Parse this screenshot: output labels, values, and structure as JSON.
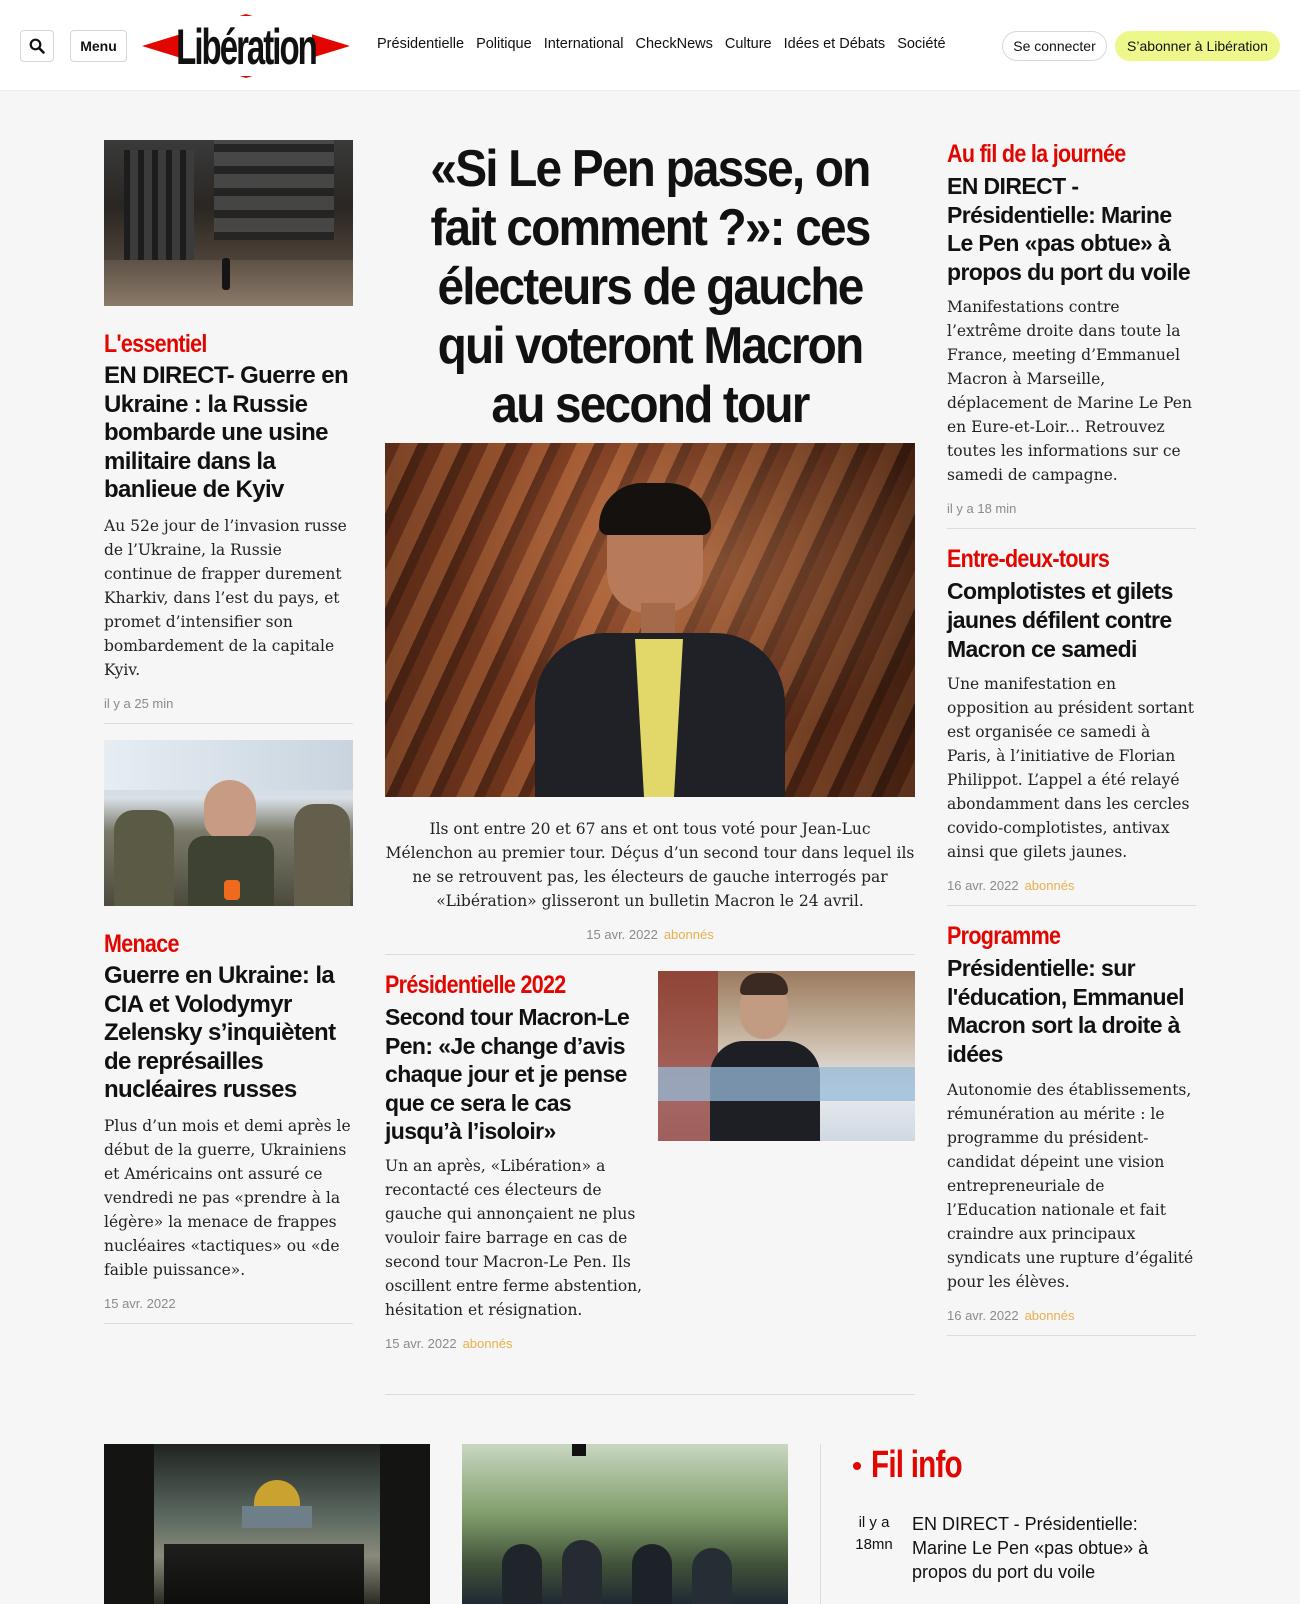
{
  "header": {
    "menu_label": "Menu",
    "logo_text": "Libération",
    "nav": [
      "Présidentielle",
      "Politique",
      "International",
      "CheckNews",
      "Culture",
      "Idées et Débats",
      "Société"
    ],
    "login_label": "Se connecter",
    "subscribe_label": "S’abonner à Libération"
  },
  "left": {
    "article1": {
      "rubric": "L'essentiel",
      "title": "EN DIRECT- Guerre en Ukraine : la Russie bombarde une usine militaire dans la banlieue de Kyiv",
      "excerpt": "Au 52e jour de l’invasion russe de l’Ukraine, la Russie continue de frapper durement Kharkiv, dans l’est du pays, et promet d’intensifier son bombardement de la capitale Kyiv.",
      "time": "il y a 25 min"
    },
    "article2": {
      "rubric": "Menace",
      "title": "Guerre en Ukraine: la CIA et Volodymyr Zelensky s’inquiètent de représailles nucléaires russes",
      "excerpt": "Plus d’un mois et demi après le début de la guerre, Ukrainiens et Américains ont assuré ce vendredi ne pas «prendre à la légère» la menace de frappes nucléaires «tactiques» ou «de faible puissance».",
      "time": "15 avr. 2022"
    }
  },
  "lead": {
    "title": "«Si Le Pen passe, on fait comment ?»: ces électeurs de gauche qui voteront Macron au second tour",
    "excerpt": "Ils ont entre 20 et 67 ans et ont tous voté pour Jean-Luc Mélenchon au premier tour. Déçus d’un second tour dans lequel ils ne se retrouvent pas, les électeurs de gauche interrogés par «Libération» glisseront un bulletin Macron le 24 avril.",
    "time": "15 avr. 2022",
    "badge": "abonnés"
  },
  "mid_secondary": {
    "rubric": "Présidentielle 2022",
    "title": "Second tour Macron-Le Pen: «Je change d’avis chaque jour et je pense que ce sera le cas jusqu’à l’isoloir»",
    "excerpt": "Un an après, «Libération» a recontacté ces électeurs de gauche qui annonçaient ne plus vouloir faire barrage en cas de second tour Macron-Le Pen. Ils oscillent entre ferme abstention, hésitation et résignation.",
    "time": "15 avr. 2022",
    "badge": "abonnés"
  },
  "right": {
    "article1": {
      "rubric": "Au fil de la journée",
      "title": "EN DIRECT - Présidentielle: Marine Le Pen «pas obtue» à propos du port du voile",
      "excerpt": "Manifestations contre l’extrême droite dans toute la France, meeting d’Emmanuel Macron à Marseille, déplacement de Marine Le Pen en Eure-et-Loir... Retrouvez toutes les informations sur ce samedi de campagne.",
      "time": "il y a 18 min"
    },
    "article2": {
      "rubric": "Entre-deux-tours",
      "title": "Complotistes et gilets jaunes défilent contre Macron ce samedi",
      "excerpt": "Une manifestation en opposition au président sortant est organisée ce samedi à Paris, à l’initiative de Florian Philippot. L’appel a été relayé abondamment dans les cercles covido-complotistes, antivax ainsi que gilets jaunes.",
      "time": "16 avr. 2022",
      "badge": "abonnés"
    },
    "article3": {
      "rubric": "Programme",
      "title": "Présidentielle: sur l'éducation, Emmanuel Macron sort la droite à idées",
      "excerpt": "Autonomie des établissements, rémunération au mérite : le programme du président-candidat dépeint une vision entrepreneuriale de l’Education nationale et fait craindre aux principaux syndicats une rupture d’égalité pour les élèves.",
      "time": "16 avr. 2022",
      "badge": "abonnés"
    }
  },
  "fil_info": {
    "title": "Fil info",
    "items": [
      {
        "time": "il y a 18mn",
        "text": "EN DIRECT - Présidentielle: Marine Le Pen «pas obtue» à propos du port du voile"
      }
    ]
  },
  "colors": {
    "accent": "#e10600",
    "subscribe_bg": "#eef78a",
    "badge": "#e8b04c"
  },
  "icons": [
    "search-icon"
  ]
}
